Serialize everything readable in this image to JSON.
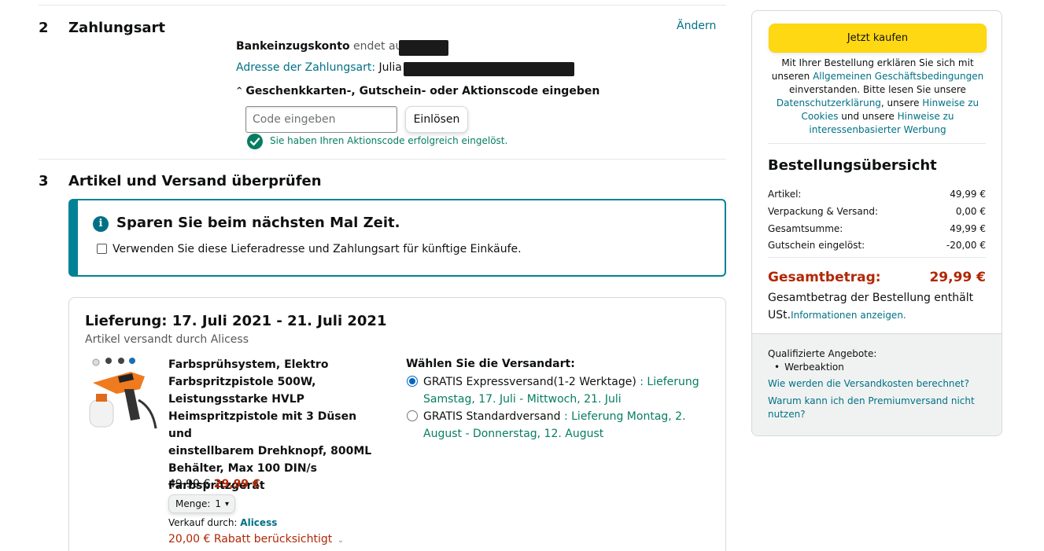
{
  "payment": {
    "number": "2",
    "title": "Zahlungsart",
    "change_link": "Ändern",
    "account_label": "Bankeinzugskonto",
    "account_suffix": "endet auf",
    "address_label": "Adresse der Zahlungsart:",
    "address_name": "Julia",
    "gift_toggle": "Geschenkkarten-, Gutschein- oder Aktionscode eingeben",
    "code_placeholder": "Code eingeben",
    "redeem_button": "Einlösen",
    "success_message": "Sie haben Ihren Aktionscode erfolgreich eingelöst."
  },
  "review": {
    "number": "3",
    "title": "Artikel und Versand überprüfen",
    "save_time_title": "Sparen Sie beim nächsten Mal Zeit.",
    "save_time_checkbox": "Verwenden Sie diese Lieferadresse und Zahlungsart für künftige Einkäufe."
  },
  "delivery": {
    "title": "Lieferung: 17. Juli 2021 - 21. Juli 2021",
    "shipped_by": "Artikel versandt durch Alicess",
    "product": {
      "name_lines": [
        "Farbsprühsystem, Elektro",
        "Farbspritzpistole 500W,",
        "Leistungsstarke HVLP",
        "Heimspritzpistole mit 3 Düsen und",
        "einstellbarem Drehknopf, 800ML",
        "Behälter, Max 100 DIN/s",
        "Farbspritzgerät"
      ],
      "old_price": "49,99 €",
      "new_price": "29,99 €",
      "quantity_label": "Menge:",
      "quantity_value": "1",
      "seller_label": "Verkauf durch:",
      "seller_name": "Alicess",
      "discount_text": "20,00 € Rabatt berücksichtigt"
    },
    "shipping": {
      "heading": "Wählen Sie die Versandart:",
      "options": [
        {
          "label": "GRATIS Expressversand(1-2 Werktage)",
          "sep": " : ",
          "detail_a": "Lieferung",
          "detail_b": "Samstag, 17. Juli - Mittwoch, 21. Juli",
          "selected": true
        },
        {
          "label": "GRATIS Standardversand",
          "sep": " : ",
          "detail_a": "Lieferung Montag, 2.",
          "detail_b": "August - Donnerstag, 12. August",
          "selected": false
        }
      ]
    }
  },
  "sidebar": {
    "buy_button": "Jetzt kaufen",
    "legal_1": "Mit Ihrer Bestellung erklären Sie sich mit",
    "legal_2a": "unseren",
    "legal_2b": "Allgemeinen Geschäftsbedingungen",
    "legal_3": "einverstanden. Bitte lesen Sie unsere",
    "legal_4a": "Datenschutzerklärung",
    "legal_4b": ", unsere",
    "legal_4c": "Hinweise zu",
    "legal_5a": "Cookies",
    "legal_5b": "und unsere",
    "legal_5c": "Hinweise zu",
    "legal_6": "interessenbasierter Werbung",
    "summary_title": "Bestellungsübersicht",
    "rows": [
      {
        "label": "Artikel:",
        "value": "49,99 €"
      },
      {
        "label": "Verpackung & Versand:",
        "value": "0,00 €"
      },
      {
        "label": "Gesamtsumme:",
        "value": "49,99 €"
      },
      {
        "label": "Gutschein eingelöst:",
        "value": "-20,00 €"
      }
    ],
    "total_label": "Gesamtbetrag:",
    "total_value": "29,99 €",
    "vat_line_1": "Gesamtbetrag der Bestellung enthält",
    "vat_line_2a": "USt.",
    "vat_line_2b": "Informationen anzeigen.",
    "qualified_title": "Qualifizierte Angebote:",
    "qualified_item": "Werbeaktion",
    "link_shipping_cost": "Wie werden die Versandkosten berechnet?",
    "link_premium_1": "Warum kann ich den Premiumversand nicht",
    "link_premium_2": "nutzen?"
  },
  "colors": {
    "buy_button": "#ffd814",
    "link": "#007185",
    "price_red": "#b12704",
    "success_green": "#067d62",
    "teal_border": "#008296"
  }
}
